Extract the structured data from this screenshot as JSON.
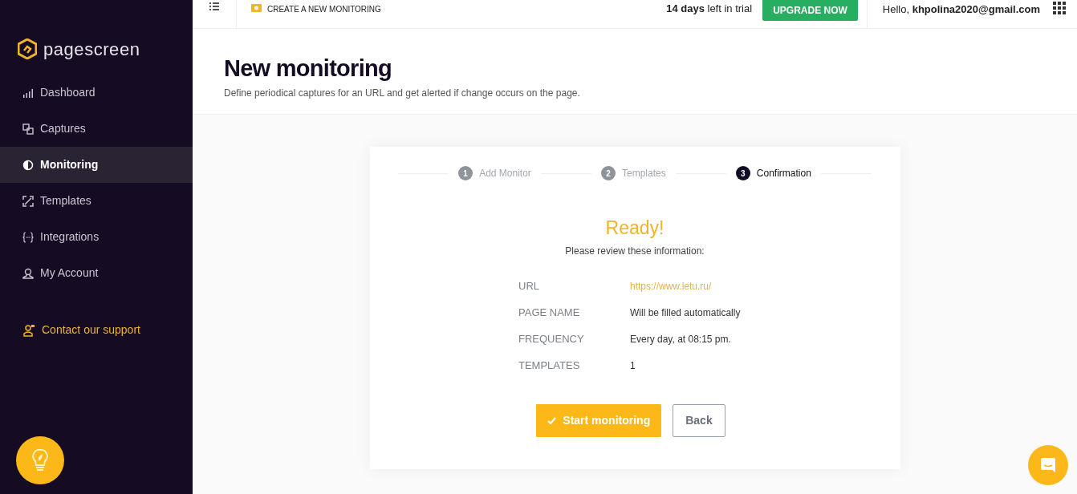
{
  "logo": {
    "text": "pagescreen"
  },
  "sidebar": {
    "items": [
      {
        "label": "Dashboard",
        "selected": false
      },
      {
        "label": "Captures",
        "selected": false
      },
      {
        "label": "Monitoring",
        "selected": true
      },
      {
        "label": "Templates",
        "selected": false
      },
      {
        "label": "Integrations",
        "selected": false
      },
      {
        "label": "My Account",
        "selected": false
      }
    ],
    "support": {
      "label": "Contact our support"
    }
  },
  "topbar": {
    "breadcrumb": "CREATE A NEW MONITORING",
    "trial": "**14 days** left in trial",
    "upgrade": "UPGRADE NOW",
    "greeting": "Hello, **khpolina2020@gmail.com**"
  },
  "header": {
    "title": "New monitoring",
    "subtitle": "Define periodical captures for an URL and get alerted if change occurs on the page."
  },
  "steps": [
    {
      "number": "1",
      "label": "Add Monitor",
      "selected": false
    },
    {
      "number": "2",
      "label": "Templates",
      "selected": false
    },
    {
      "number": "3",
      "label": "Confirmation",
      "selected": true
    }
  ],
  "summary": {
    "heading": "Ready!",
    "intro": "Please review these information:",
    "rows": [
      {
        "label": "URL",
        "value": "https://www.letu.ru/",
        "kind": "link"
      },
      {
        "label": "PAGE NAME",
        "value": "Will be filled automatically",
        "kind": "text"
      },
      {
        "label": "FREQUENCY",
        "value": "Every day, at 08:15 pm.",
        "kind": "text"
      },
      {
        "label": "TEMPLATES",
        "value": "1",
        "kind": "text"
      }
    ]
  },
  "buttons": {
    "start": "Start monitoring",
    "back": "Back"
  }
}
